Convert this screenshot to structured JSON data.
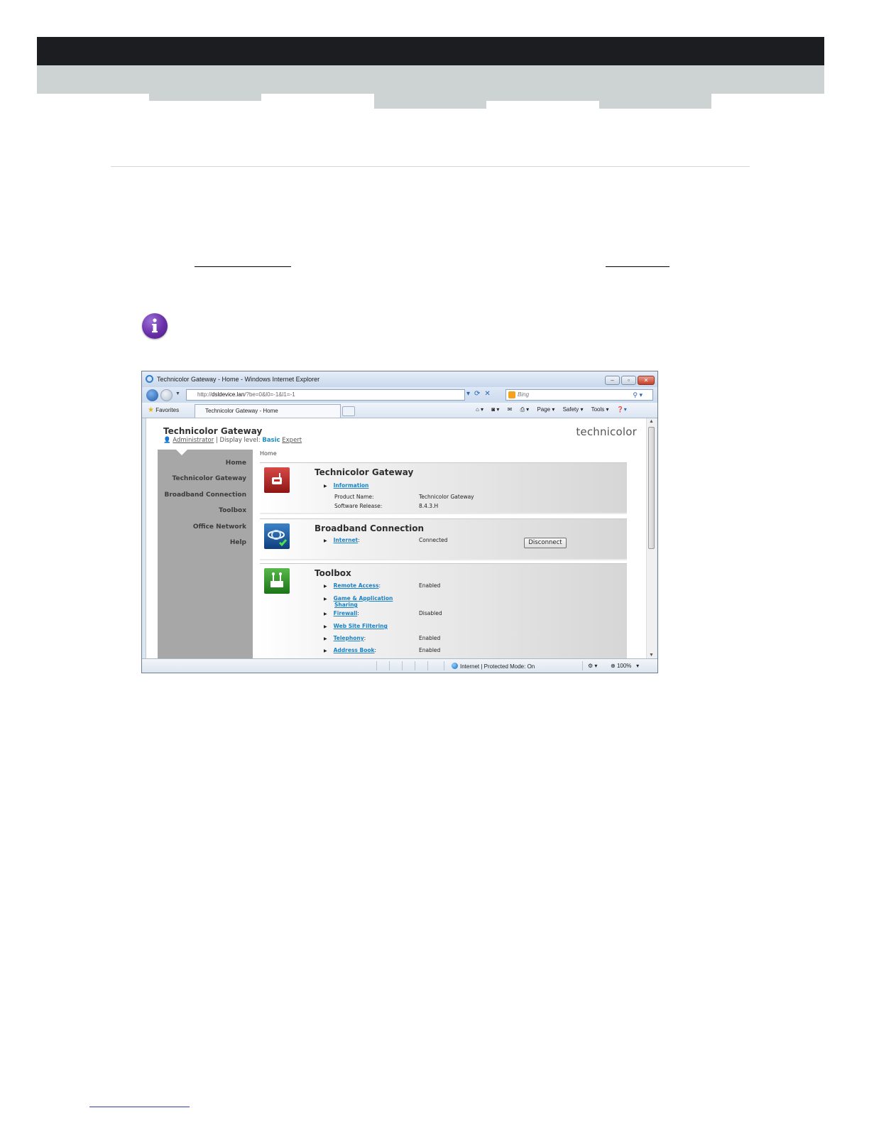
{
  "browser": {
    "window_title": "Technicolor Gateway - Home - Windows Internet Explorer",
    "address_prefix": "http://",
    "address_host": "dsldevice.lan",
    "address_rest": "/?be=0&l0=-1&l1=-1",
    "search_placeholder": "Bing",
    "favorites_label": "Favorites",
    "tab_label": "Technicolor Gateway - Home",
    "cmd_page": "Page ▾",
    "cmd_safety": "Safety ▾",
    "cmd_tools": "Tools ▾",
    "status_zone": "Internet | Protected Mode: On",
    "zoom": "100%"
  },
  "gateway": {
    "title": "Technicolor Gateway",
    "user": "Administrator",
    "display_level_label": "| Display level:",
    "level_basic": "Basic",
    "level_expert": "Expert",
    "logo": "technicolor",
    "breadcrumb": "Home",
    "sidebar": [
      "Home",
      "Technicolor Gateway",
      "Broadband Connection",
      "Toolbox",
      "Office Network",
      "Help"
    ],
    "cards": {
      "gateway": {
        "title": "Technicolor Gateway",
        "link": "Information",
        "product_label": "Product Name:",
        "product_value": "Technicolor Gateway",
        "release_label": "Software Release:",
        "release_value": "8.4.3.H"
      },
      "broadband": {
        "title": "Broadband Connection",
        "link": "Internet",
        "status": "Connected",
        "button": "Disconnect"
      },
      "toolbox": {
        "title": "Toolbox",
        "items": [
          {
            "link": "Remote Access",
            "value": "Enabled"
          },
          {
            "link": "Game & Application",
            "link2": "Sharing",
            "value": ""
          },
          {
            "link": "Firewall",
            "value": "Disabled"
          },
          {
            "link": "Web Site Filtering",
            "value": ""
          },
          {
            "link": "Telephony",
            "value": "Enabled"
          },
          {
            "link": "Address Book",
            "value": "Enabled"
          }
        ]
      }
    }
  }
}
